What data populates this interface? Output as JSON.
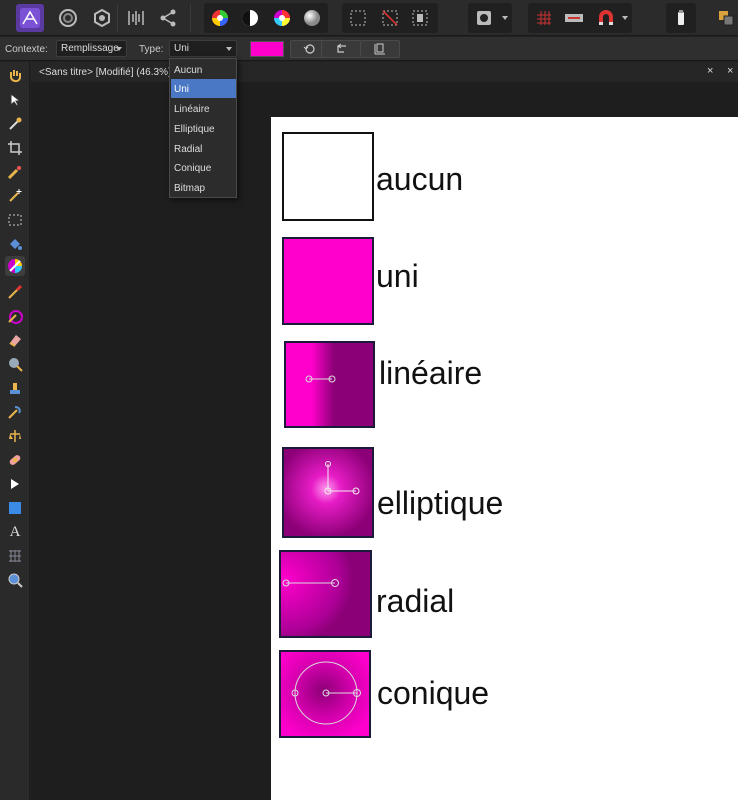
{
  "contextbar": {
    "context_label": "Contexte:",
    "context_value": "Remplissage",
    "type_label": "Type:",
    "type_value": "Uni",
    "fill_color": "#ff00cc"
  },
  "dropdown": {
    "options": [
      "Aucun",
      "Uni",
      "Linéaire",
      "Elliptique",
      "Radial",
      "Conique",
      "Bitmap"
    ],
    "selected": "Uni"
  },
  "document": {
    "tab_title": "<Sans titre> [Modifié] (46.3%)",
    "close_glyph": "×"
  },
  "canvas": {
    "items": [
      {
        "label": "aucun",
        "fill": "none"
      },
      {
        "label": "uni",
        "fill": "solid"
      },
      {
        "label": "linéaire",
        "fill": "linear"
      },
      {
        "label": "elliptique",
        "fill": "elliptical"
      },
      {
        "label": "radial",
        "fill": "radial"
      },
      {
        "label": "conique",
        "fill": "conical"
      }
    ]
  },
  "colors": {
    "magenta": "#ff00cc",
    "dark_magenta": "#8c0077",
    "selection": "#4a78c4"
  },
  "icons": {
    "toolbar": [
      "affinity-photo-logo",
      "photo-persona-icon",
      "liquify-persona-icon",
      "develop-persona-icon",
      "tone-mapping-persona-icon",
      "export-persona-icon",
      "color-wheel-icon",
      "contrast-icon",
      "hsl-icon",
      "gradient-ball-icon",
      "marquee-icon",
      "no-select-icon",
      "invert-selection-icon",
      "quick-mask-icon",
      "snapping-grid-icon",
      "magnet-icon",
      "arrange-icon"
    ],
    "tools": [
      "hand-icon",
      "move-icon",
      "color-picker-icon",
      "crop-icon",
      "selection-brush-icon",
      "flood-select-icon",
      "marquee-tool-icon",
      "flood-fill-icon",
      "gradient-icon",
      "paint-brush-icon",
      "color-replacement-icon",
      "erase-icon",
      "dodge-icon",
      "clone-icon",
      "smudge-icon",
      "healing-icon",
      "patch-icon",
      "node-icon",
      "rectangle-icon",
      "text-icon",
      "mesh-warp-icon",
      "zoom-icon"
    ]
  }
}
